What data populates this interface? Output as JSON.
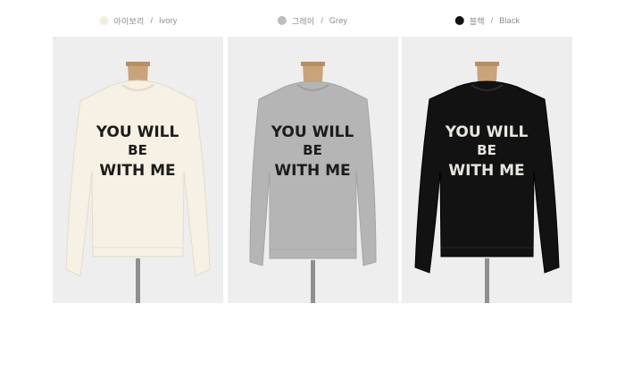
{
  "colors": [
    {
      "name_ko": "아이보리",
      "name_en": "Ivory",
      "swatch": "#f3ede1",
      "sweater": "#f6f1e4",
      "text": "#1c1c1c"
    },
    {
      "name_ko": "그레이",
      "name_en": "Grey",
      "swatch": "#bdbdbd",
      "sweater": "#b5b5b5",
      "text": "#1c1c1c"
    },
    {
      "name_ko": "블랙",
      "name_en": "Black",
      "swatch": "#111111",
      "sweater": "#121212",
      "text": "#e9e6df"
    }
  ],
  "print": {
    "line1": "YOU WILL",
    "line2": "BE",
    "line3": "WITH ME"
  },
  "separator": "/"
}
